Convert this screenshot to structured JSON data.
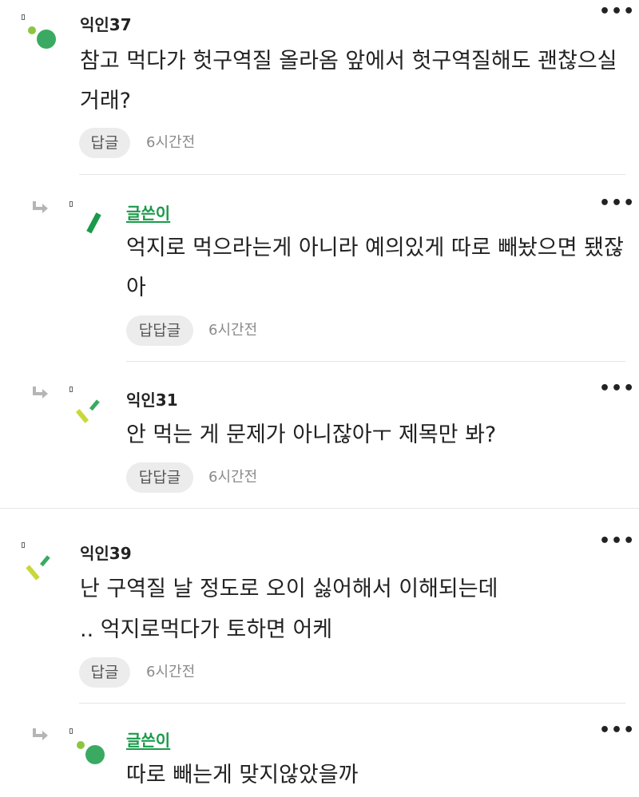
{
  "comments": [
    {
      "author": "익인37",
      "lines": [
        "참고 먹다가 헛구역질 올라옴 앞에서 헛구역질해도 괜찮으실",
        "거래?"
      ],
      "reply_label": "답글",
      "time": "6시간전"
    },
    {
      "author": "글쓴이",
      "lines": [
        "억지로 먹으라는게 아니라 예의있게 따로 빼놨으면 됐잖",
        "아"
      ],
      "reply_label": "답답글",
      "time": "6시간전"
    },
    {
      "author": "익인31",
      "lines": [
        "안 먹는 게 문제가 아니잖아ㅜ 제목만 봐?"
      ],
      "reply_label": "답답글",
      "time": "6시간전"
    },
    {
      "author": "익인39",
      "lines": [
        "난 구역질 날 정도로 오이 싫어해서 이해되는데",
        ".. 억지로먹다가 토하면 어케"
      ],
      "reply_label": "답글",
      "time": "6시간전"
    },
    {
      "author": "글쓴이",
      "lines": [
        "따로 빼는게 맞지않았을까"
      ]
    }
  ],
  "more_label": "•••",
  "colors": {
    "accent_green": "#1a9a4a",
    "lime": "#8cc63f",
    "yellow_green": "#c8d83a"
  }
}
